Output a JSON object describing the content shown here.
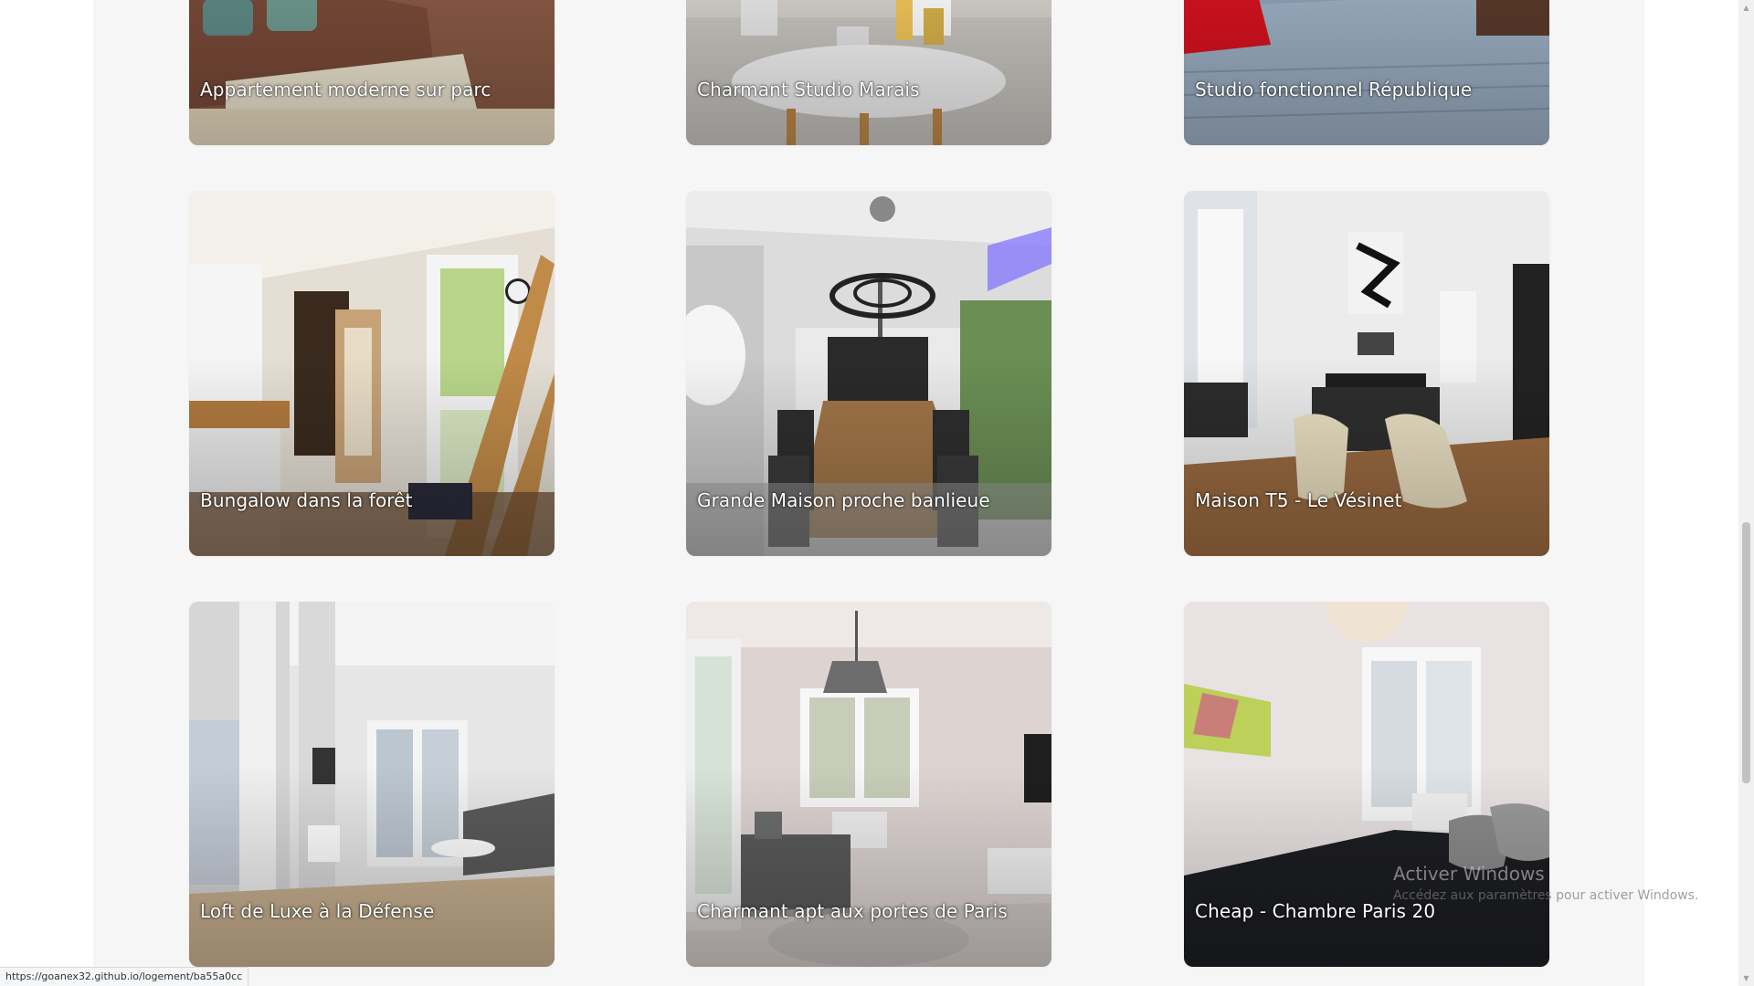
{
  "listings": [
    {
      "title": "Appartement moderne sur parc"
    },
    {
      "title": "Charmant Studio Marais"
    },
    {
      "title": "Studio fonctionnel République"
    },
    {
      "title": "Bungalow dans la forêt"
    },
    {
      "title": "Grande Maison proche banlieue"
    },
    {
      "title": "Maison T5 - Le Vésinet"
    },
    {
      "title": "Loft de Luxe à la Défense"
    },
    {
      "title": "Charmant apt aux portes de Paris"
    },
    {
      "title": "Cheap - Chambre Paris 20"
    }
  ],
  "status_bar": {
    "url": "https://goanex32.github.io/logement/ba55a0cc"
  },
  "watermark": {
    "title": "Activer Windows",
    "subtitle": "Accédez aux paramètres pour activer Windows."
  },
  "colors": {
    "page_background": "#ffffff",
    "gallery_background": "#f6f6f6",
    "card_title_text": "#ffffff"
  }
}
